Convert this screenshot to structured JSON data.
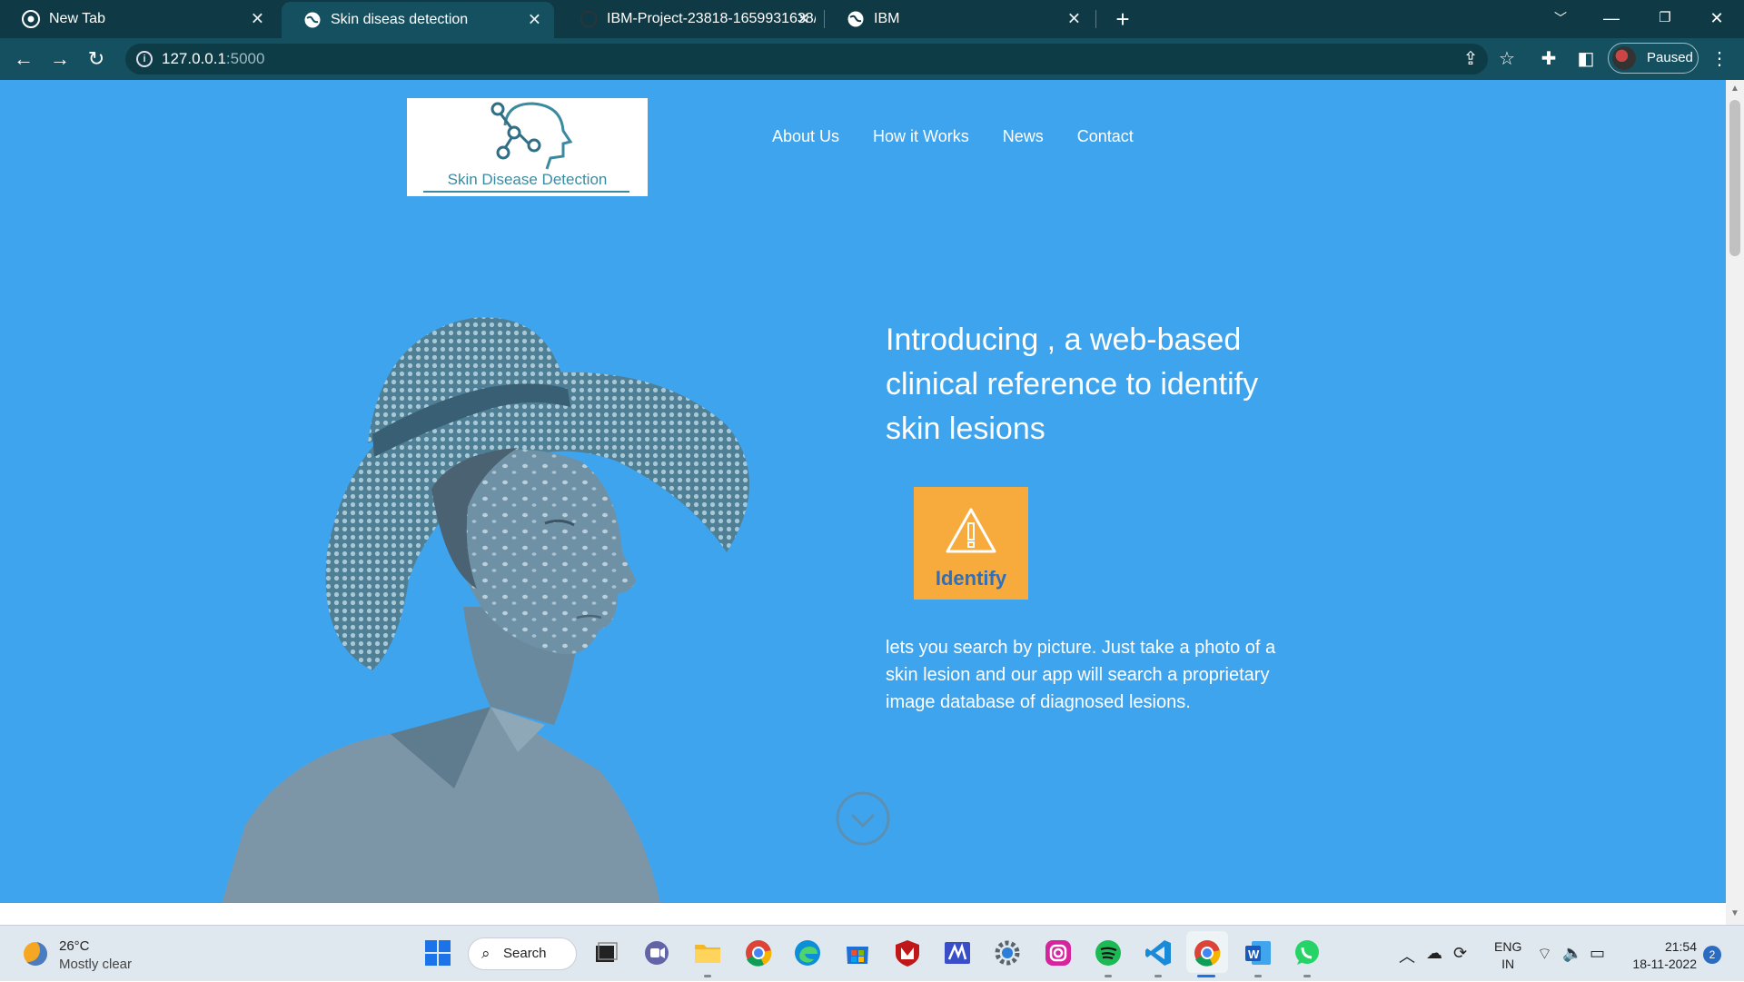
{
  "browser": {
    "tabs": [
      {
        "label": "New Tab",
        "icon": "chrome-icon",
        "active": false
      },
      {
        "label": "Skin diseas detection",
        "icon": "globe-icon",
        "active": true
      },
      {
        "label": "IBM-Project-23818-1659931638/",
        "icon": "github-icon",
        "active": false
      },
      {
        "label": "IBM",
        "icon": "globe-icon",
        "active": false
      }
    ],
    "address": {
      "host": "127.0.0.1",
      "port": ":5000"
    },
    "profile_label": "Paused"
  },
  "page": {
    "logo_text": "Skin Disease Detection",
    "nav": [
      "About Us",
      "How it Works",
      "News",
      "Contact"
    ],
    "hero": {
      "heading": "Introducing , a web-based clinical reference to identify skin lesions",
      "identify_label": "Identify",
      "description": "lets you search by picture. Just take a photo of a skin lesion and our app will search a proprietary image database of diagnosed lesions."
    },
    "colors": {
      "page_bg": "#3fa4ee",
      "identify_bg": "#f6ab3c",
      "identify_text": "#2d6fc0"
    }
  },
  "taskbar": {
    "weather": {
      "temp": "26°C",
      "condition": "Mostly clear"
    },
    "search_label": "Search",
    "lang": {
      "line1": "ENG",
      "line2": "IN"
    },
    "clock": {
      "time": "21:54",
      "date": "18-11-2022"
    },
    "notifications": "2"
  }
}
